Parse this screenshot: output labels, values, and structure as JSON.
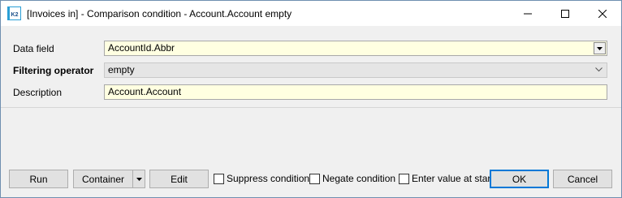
{
  "window": {
    "title": "[Invoices in] - Comparison condition - Account.Account empty",
    "app_icon_text": "K2"
  },
  "form": {
    "data_field_label": "Data field",
    "data_field_value": "AccountId.Abbr",
    "filtering_operator_label": "Filtering operator",
    "filtering_operator_value": "empty",
    "description_label": "Description",
    "description_value": "Account.Account"
  },
  "buttons": {
    "run": "Run",
    "container": "Container",
    "edit": "Edit",
    "ok": "OK",
    "cancel": "Cancel"
  },
  "checkboxes": {
    "suppress": {
      "label": "Suppress condition",
      "checked": false
    },
    "negate": {
      "label": "Negate condition",
      "checked": false
    },
    "enter_value": {
      "label": "Enter value at start",
      "checked": false
    }
  },
  "colors": {
    "input_background": "#ffffe1",
    "accent": "#0078d7"
  }
}
